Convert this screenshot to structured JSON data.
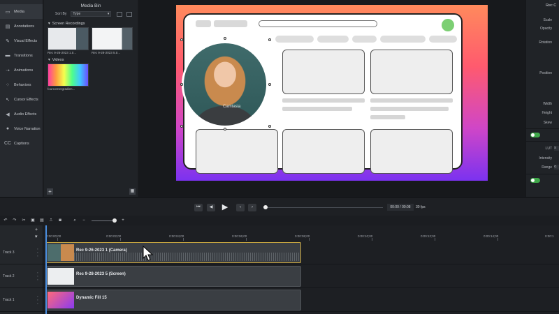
{
  "tools": [
    {
      "label": "Media",
      "icon": "media-icon"
    },
    {
      "label": "Annotations",
      "icon": "annotations-icon"
    },
    {
      "label": "Visual Effects",
      "icon": "visual-effects-icon"
    },
    {
      "label": "Transitions",
      "icon": "transitions-icon"
    },
    {
      "label": "Animations",
      "icon": "animations-icon"
    },
    {
      "label": "Behaviors",
      "icon": "behaviors-icon"
    },
    {
      "label": "Cursor Effects",
      "icon": "cursor-effects-icon"
    },
    {
      "label": "Audio Effects",
      "icon": "audio-effects-icon"
    },
    {
      "label": "Voice Narration",
      "icon": "voice-narration-icon"
    },
    {
      "label": "Captions",
      "icon": "captions-icon"
    }
  ],
  "media_bin": {
    "title": "Media Bin",
    "sort_label": "Sort By",
    "sort_value": "Type",
    "section_recordings": "Screen Recordings",
    "section_videos": "Videos",
    "recordings": [
      {
        "name": "Rec 9-26-2023 1.tr..."
      },
      {
        "name": "Rec 9-28-2023 5.tr..."
      }
    ],
    "videos": [
      {
        "name": "fourcornergradien..."
      }
    ]
  },
  "canvas": {
    "watermark": "Camtasia"
  },
  "properties": {
    "title": "Rec C",
    "scale": "Scale",
    "opacity": "Opacity",
    "rotation": "Rotation",
    "position": "Position",
    "width": "Width",
    "height": "Height",
    "skew": "Skew",
    "lut": "LUT",
    "intensity": "Intensity",
    "range": "Range",
    "lut_value": "S",
    "range_value": "G"
  },
  "player": {
    "time": "00:00 / 00:08",
    "fps": "30 fps"
  },
  "timeline": {
    "playhead_time": "0:00:00;00",
    "ticks": [
      "0:00:00;00",
      "0:00:02;00",
      "0:00:04;00",
      "0:00:06;00",
      "0:00:08;00",
      "0:00:10;00",
      "0:00:12;00",
      "0:00:14;00",
      "0:00:1"
    ],
    "tracks": [
      {
        "label": "Track 3",
        "clip": "Rec 9-26-2023 1 (Camera)"
      },
      {
        "label": "Track 2",
        "clip": "Rec 9-28-2023 5 (Screen)"
      },
      {
        "label": "Track 1",
        "clip": "Dynamic Fill 15"
      }
    ]
  }
}
